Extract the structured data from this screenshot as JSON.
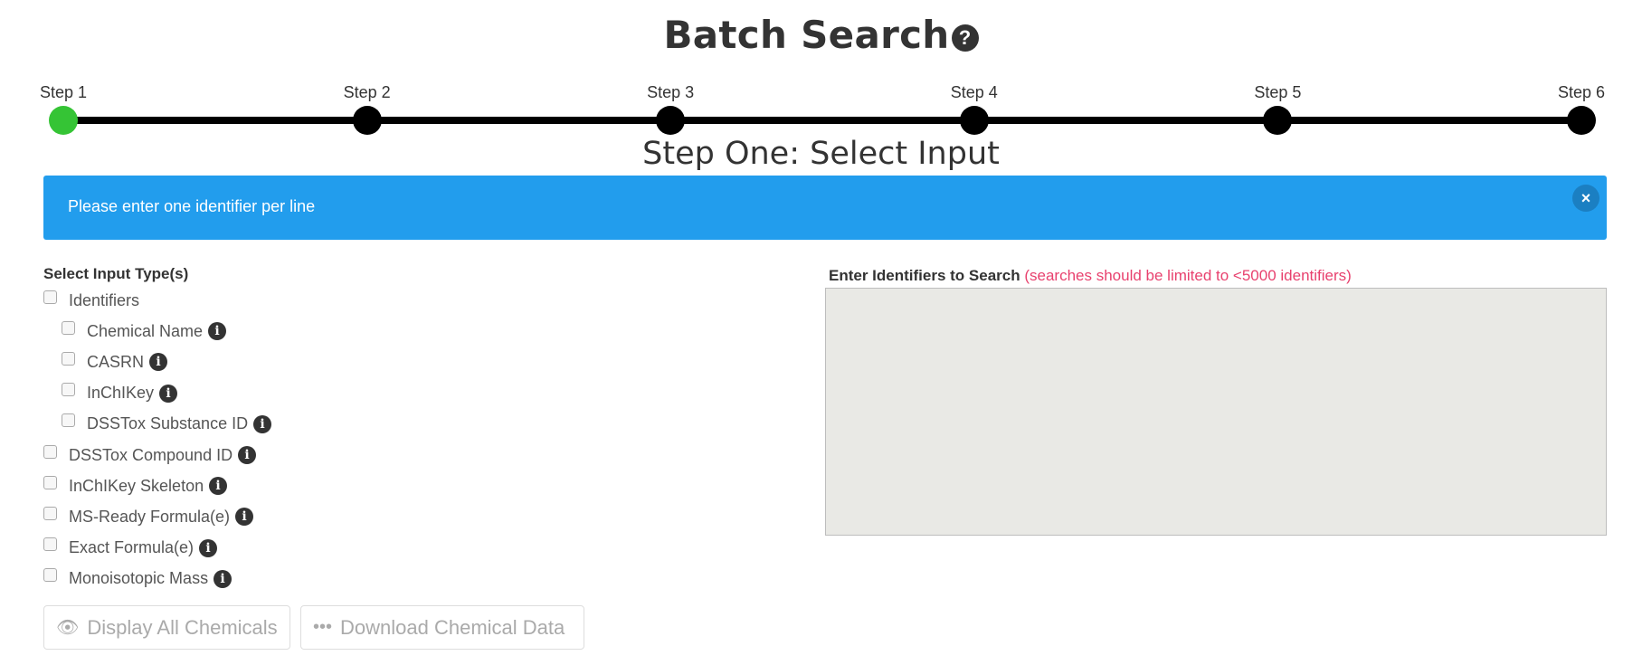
{
  "header": {
    "title": "Batch Search",
    "help_icon": "question-circle"
  },
  "stepper": {
    "steps": [
      {
        "label": "Step 1"
      },
      {
        "label": "Step 2"
      },
      {
        "label": "Step 3"
      },
      {
        "label": "Step 4"
      },
      {
        "label": "Step 5"
      },
      {
        "label": "Step 6"
      }
    ],
    "active_step": 1,
    "active_color": "#35c435",
    "inactive_color": "#000000"
  },
  "subtitle": "Step One: Select Input",
  "alert": {
    "text": "Please enter one identifier per line",
    "close_label": "×",
    "color": "#229ded"
  },
  "input_types": {
    "heading": "Select Input Type(s)",
    "options": [
      {
        "label": "Identifiers",
        "checked": false
      },
      {
        "label": "Chemical Name",
        "checked": false
      },
      {
        "label": "CASRN",
        "checked": false
      },
      {
        "label": "InChIKey",
        "checked": false
      },
      {
        "label": "DSSTox Substance ID",
        "checked": false
      },
      {
        "label": "DSSTox Compound ID",
        "checked": false
      },
      {
        "label": "InChIKey Skeleton",
        "checked": false
      },
      {
        "label": "MS-Ready Formula(e)",
        "checked": false
      },
      {
        "label": "Exact Formula(e)",
        "checked": false
      },
      {
        "label": "Monoisotopic Mass",
        "checked": false
      }
    ]
  },
  "identifiers": {
    "heading": "Enter Identifiers to Search",
    "note": "(searches should be limited to <5000 identifiers)",
    "value": ""
  },
  "buttons": {
    "display_all": "Display All Chemicals",
    "download": "Download Chemical Data"
  }
}
